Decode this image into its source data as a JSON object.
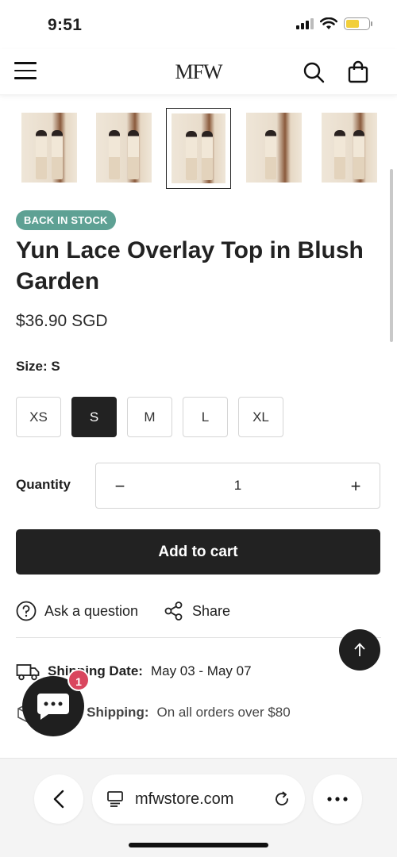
{
  "status_bar": {
    "time": "9:51"
  },
  "header": {
    "logo": "MFW"
  },
  "product": {
    "badge": "BACK IN STOCK",
    "title": "Yun Lace Overlay Top in Blush Garden",
    "price": "$36.90 SGD",
    "size_label": "Size:",
    "size_value": "S",
    "sizes": [
      "XS",
      "S",
      "M",
      "L",
      "XL"
    ],
    "selected_size": "S",
    "quantity_label": "Quantity",
    "quantity": "1",
    "add_to_cart": "Add to cart"
  },
  "actions": {
    "ask": "Ask a question",
    "share": "Share"
  },
  "shipping": {
    "date_label": "Shipping Date:",
    "date_value": "May 03 - May 07",
    "local_label": "Local Shipping:",
    "local_value": "On all orders over $80"
  },
  "chat": {
    "badge_count": "1"
  },
  "browser": {
    "url": "mfwstore.com"
  },
  "colors": {
    "badge": "#5ea194",
    "primary": "#222222",
    "chat_badge": "#d9465e"
  }
}
